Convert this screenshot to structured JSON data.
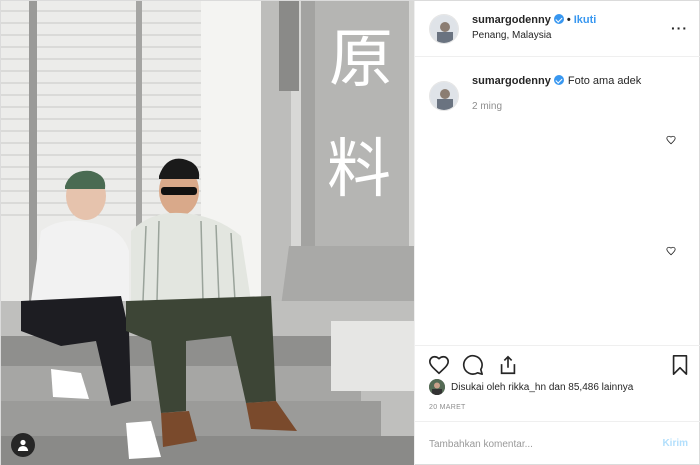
{
  "header": {
    "username": "sumargodenny",
    "separator": "•",
    "follow_label": "Ikuti",
    "location": "Penang, Malaysia",
    "more_label": "···"
  },
  "caption": {
    "username": "sumargodenny",
    "text": "Foto ama adek",
    "time": "2 ming"
  },
  "photo": {
    "pillar_chars": [
      "原",
      "料"
    ]
  },
  "likes": {
    "text": "Disukai oleh rikka_hn dan 85,486 lainnya"
  },
  "date": "20 MARET",
  "comment": {
    "placeholder": "Tambahkan komentar...",
    "post_label": "Kirim"
  },
  "colors": {
    "accent": "#3897f0",
    "post_disabled": "#b2dffc"
  },
  "icons": [
    "heart-icon",
    "comment-icon",
    "share-icon",
    "bookmark-icon",
    "verified-icon",
    "person-tag-icon"
  ]
}
